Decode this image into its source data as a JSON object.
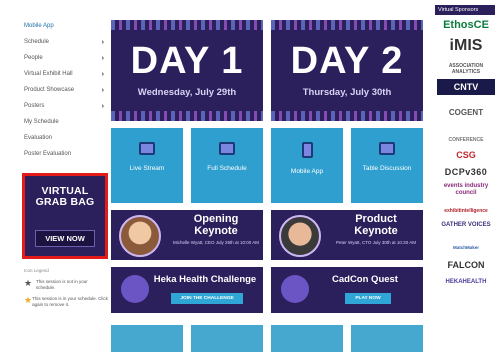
{
  "sidebar": {
    "nav": [
      {
        "label": "Mobile App",
        "chevron": ""
      },
      {
        "label": "Schedule",
        "chevron": "›"
      },
      {
        "label": "People",
        "chevron": "›"
      },
      {
        "label": "Virtual Exhibit Hall",
        "chevron": "›"
      },
      {
        "label": "Product Showcase",
        "chevron": "›"
      },
      {
        "label": "Posters",
        "chevron": "›"
      },
      {
        "label": "My Schedule",
        "chevron": ""
      },
      {
        "label": "Evaluation",
        "chevron": ""
      },
      {
        "label": "Poster Evaluation",
        "chevron": ""
      }
    ],
    "grab_bag": {
      "title_line1": "VIRTUAL",
      "title_line2": "GRAB BAG",
      "button": "VIEW NOW"
    },
    "legend": {
      "title": "Icon Legend",
      "items": [
        {
          "text": "This session is not in your schedule.",
          "color": "#555555"
        },
        {
          "text": "This session is in your schedule. Click again to remove it.",
          "color": "#f0a92b"
        }
      ]
    }
  },
  "main": {
    "days": [
      {
        "title": "DAY 1",
        "date": "Wednesday, July 29th"
      },
      {
        "title": "DAY 2",
        "date": "Thursday, July 30th"
      }
    ],
    "tiles": [
      {
        "label": "Live Stream"
      },
      {
        "label": "Full Schedule"
      },
      {
        "label": "Mobile App"
      },
      {
        "label": "Table Discussion"
      }
    ],
    "keynotes": [
      {
        "title": "Opening Keynote",
        "detail": "Michelle Wyatt, CEO July 29th at 10:00 AM"
      },
      {
        "title": "Product Keynote",
        "detail": "Peter Wyatt, CTO July 30th at 10:30 AM"
      }
    ],
    "banners": [
      {
        "title": "Heka Health Challenge",
        "button": "JOIN THE CHALLENGE"
      },
      {
        "title": "CadCon Quest",
        "button": "PLAY NOW"
      }
    ]
  },
  "sponsors": {
    "header": "Virtual Sponsors",
    "logos": [
      {
        "name": "EthosCE",
        "color": "#0a7d3c"
      },
      {
        "name": "iMIS",
        "color": "#222222"
      },
      {
        "name": "ASSOCIATION ANALYTICS",
        "color": "#555555"
      },
      {
        "name": "CNTV",
        "color": "#1a1a4a"
      },
      {
        "name": "COGENT",
        "color": "#555555"
      },
      {
        "name": "CONFERENCE",
        "color": "#777777"
      },
      {
        "name": "CSG",
        "color": "#c0282e"
      },
      {
        "name": "DCPv360",
        "color": "#333333"
      },
      {
        "name": "events industry council",
        "color": "#8a2a7a"
      },
      {
        "name": "exhibitintelligence",
        "color": "#b0202a"
      },
      {
        "name": "GATHER VOICES",
        "color": "#3b2f7a"
      },
      {
        "name": "MatchMaker",
        "color": "#2d5fa8"
      },
      {
        "name": "FALCON",
        "color": "#111111"
      },
      {
        "name": "HEKAHEALTH",
        "color": "#4a3a9a"
      }
    ]
  }
}
